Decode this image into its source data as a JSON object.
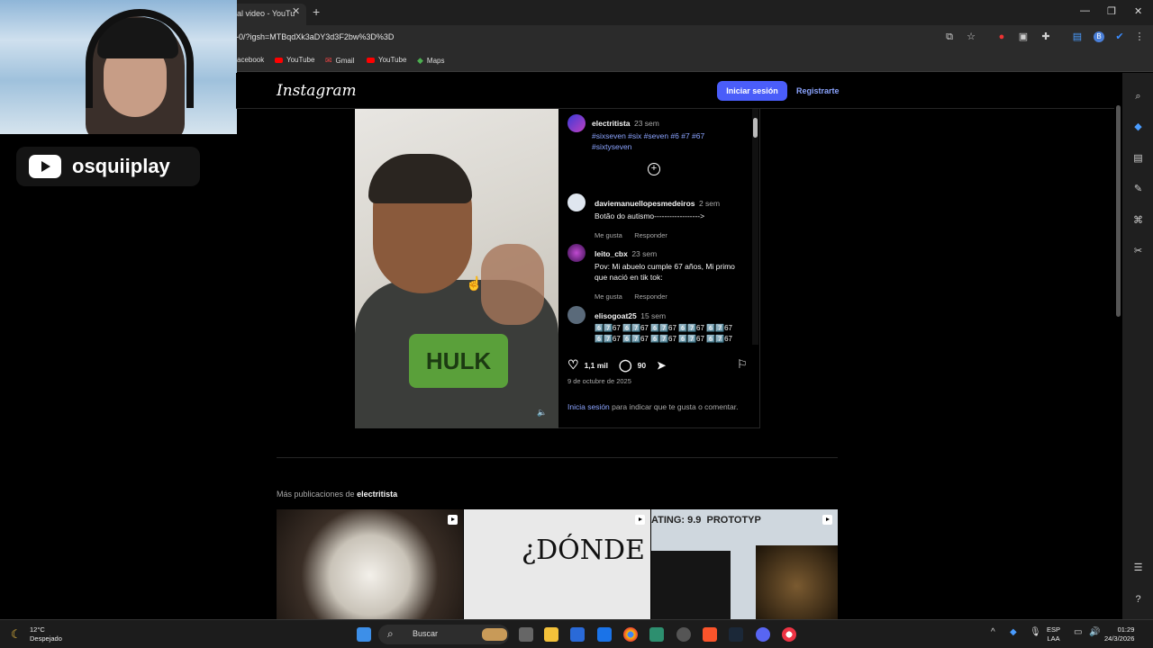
{
  "browser": {
    "tab_title": "al video - YouTu",
    "url": "-0/?igsh=MTBqdXk3aDY3d3F2bw%3D%3D",
    "bookmarks": [
      "acebook",
      "YouTube",
      "Gmail",
      "YouTube",
      "Maps"
    ],
    "window_controls": [
      "minimize-icon",
      "restore-icon",
      "close-icon"
    ]
  },
  "stream": {
    "channel_name": "osquiiplay"
  },
  "instagram": {
    "logo": "Instagram",
    "login_label": "Iniciar sesión",
    "signup_label": "Registrarte",
    "post": {
      "author": "electritista",
      "author_time": "23 sem",
      "caption_hashtags": "#sixseven #six #seven #6 #7 #67 #sixtyseven",
      "comments": [
        {
          "user": "daviemanuellopesmedeiros",
          "time": "2 sem",
          "text": "Botão do autismo------------------>",
          "like": "Me gusta",
          "reply": "Responder"
        },
        {
          "user": "leito_cbx",
          "time": "23 sem",
          "text": "Pov: Mi abuelo cumple 67 años, Mi primo que nació en tik tok:",
          "like": "Me gusta",
          "reply": "Responder"
        },
        {
          "user": "elisogoat25",
          "time": "15 sem",
          "text": "6️⃣7️⃣67 6️⃣7️⃣67 6️⃣7️⃣67 6️⃣7️⃣67 6️⃣7️⃣67 6️⃣7️⃣67 6️⃣7️⃣67 6️⃣7️⃣67 6️⃣7️⃣67 6️⃣7️⃣67 6️⃣7️⃣67 6️⃣7️⃣67"
        }
      ],
      "likes": "1,1 mil",
      "comments_count": "90",
      "date": "9 de octubre de 2025",
      "login_prompt_link": "Inicia sesión",
      "login_prompt_rest": " para indicar que te gusta o comentar."
    },
    "more_label": "Más publicaciones de ",
    "more_user": "electritista",
    "thumbs": [
      "",
      "¿DÓNDE",
      "ATING: 9.9  PROTOTYP"
    ]
  },
  "taskbar": {
    "weather_temp": "12°C",
    "weather_desc": "Despejado",
    "search_placeholder": "Buscar",
    "lang_top": "ESP",
    "lang_bottom": "LAA",
    "time": "01:29",
    "date": "24/3/2026"
  },
  "colors": {
    "accent": "#4a5df9",
    "link": "#8ba4ff",
    "bg": "#000000"
  }
}
